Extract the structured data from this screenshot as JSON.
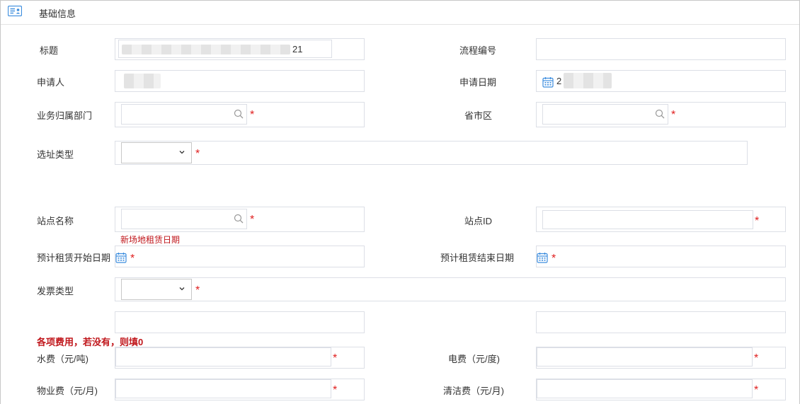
{
  "section": {
    "title": "基础信息",
    "icon": "form-icon"
  },
  "fields": {
    "title": {
      "label": "标题",
      "value_suffix": "21"
    },
    "process_no": {
      "label": "流程编号"
    },
    "applicant": {
      "label": "申请人"
    },
    "apply_date": {
      "label": "申请日期",
      "value_prefix": "2"
    },
    "department": {
      "label": "业务归属部门"
    },
    "region": {
      "label": "省市区"
    },
    "site_type": {
      "label": "选址类型"
    },
    "site_name": {
      "label": "站点名称",
      "note": "新场地租赁日期"
    },
    "site_id": {
      "label": "站点ID"
    },
    "lease_start": {
      "label": "预计租赁开始日期"
    },
    "lease_end": {
      "label": "预计租赁结束日期"
    },
    "invoice_type": {
      "label": "发票类型"
    },
    "fees_note": "各项费用，若没有，则填0",
    "water_fee": {
      "label": "水费（元/吨)"
    },
    "electric_fee": {
      "label": "电费（元/度)"
    },
    "property_fee": {
      "label": "物业费（元/月)"
    },
    "cleaning_fee": {
      "label": "清洁费（元/月)"
    }
  },
  "required_mark": "*",
  "colors": {
    "required": "#e02020",
    "note": "#c0161b",
    "border": "#dcdfe6",
    "icon_blue": "#3c8dde"
  }
}
